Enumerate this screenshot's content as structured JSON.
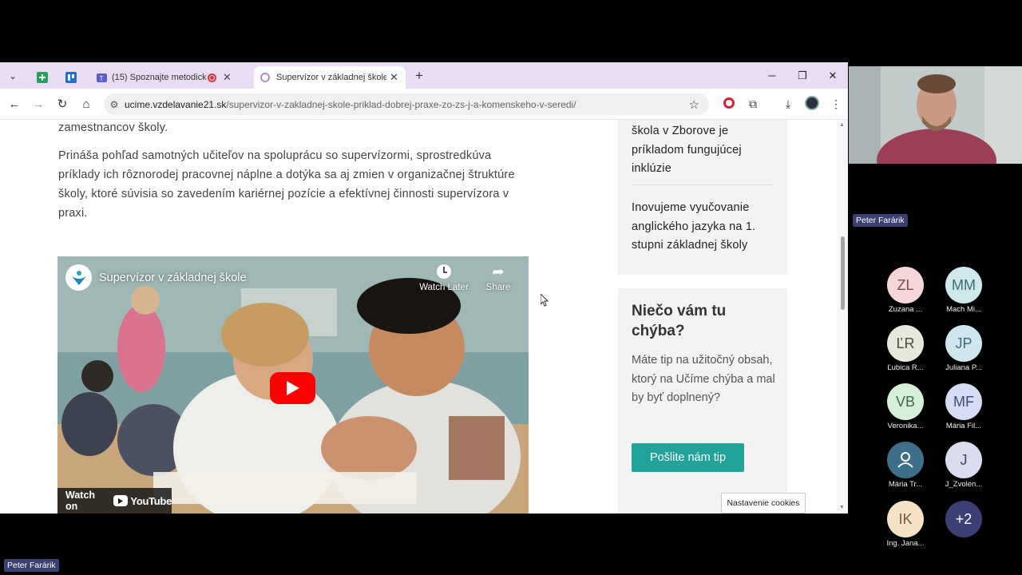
{
  "browser": {
    "tabs": [
      {
        "label": "(15) Spoznajte metodický p",
        "active": false
      },
      {
        "label": "Supervízor v základnej škole - p",
        "active": true
      }
    ],
    "url_domain": "ucime.vzdelavanie21.sk",
    "url_path": "/supervizor-v-zakladnej-skole-priklad-dobrej-praxe-zo-zs-j-a-komenskeho-v-seredi/"
  },
  "article": {
    "para1_tail": "zamestnancov školy.",
    "para2": "Prináša pohľad samotných učiteľov na spoluprácu so supervízormi, sprostredkúva príklady ich rôznorodej pracovnej náplne a dotýka sa aj zmien v organizačnej štruktúre školy, ktoré súvisia so zavedením kariérnej pozície a efektívnej činnosti supervízora v praxi."
  },
  "video": {
    "title": "Supervízor v základnej škole",
    "watch_later": "Watch Later",
    "share": "Share",
    "watch_on": "Watch on",
    "youtube": "YouTube"
  },
  "sidebar": {
    "link1": "škola v Zborove je príkladom fungujúcej inklúzie",
    "link2": "Inovujeme vyučovanie anglického jazyka na 1. stupni základnej školy",
    "heading": "Niečo vám tu chýba?",
    "text": "Máte tip na užitočný obsah, ktorý na Učíme chýba a mal by byť doplnený?",
    "button": "Pošlite nám tip"
  },
  "cookie_button": "Nastavenie cookies",
  "meeting": {
    "speaker": "Peter Farárik",
    "participants": [
      {
        "initials": "ZL",
        "name": "Zuzana ...",
        "bg": "#f6d6d8",
        "fg": "#7a4b4e"
      },
      {
        "initials": "MM",
        "name": "Mach Mi...",
        "bg": "#cfe8ec",
        "fg": "#3e6b72"
      },
      {
        "initials": "ĽR",
        "name": "Ľubica R...",
        "bg": "#e6e8dc",
        "fg": "#4a4c3e"
      },
      {
        "initials": "JP",
        "name": "Juliana P...",
        "bg": "#cfe6ee",
        "fg": "#3f6c7a"
      },
      {
        "initials": "VB",
        "name": "Veronika...",
        "bg": "#d5efd8",
        "fg": "#3f6b46"
      },
      {
        "initials": "MF",
        "name": "Mária Fil...",
        "bg": "#d5dcf3",
        "fg": "#3d4a7a"
      },
      {
        "initials": "",
        "name": "Mária Tr...",
        "bg": "#3d6f8a",
        "fg": "#ffffff"
      },
      {
        "initials": "J",
        "name": "J_Zvolen...",
        "bg": "#dcdcf1",
        "fg": "#3c3d6b"
      },
      {
        "initials": "IK",
        "name": "Ing. Jana...",
        "bg": "#f5e2c6",
        "fg": "#7a5730"
      },
      {
        "initials": "+2",
        "name": "",
        "bg": "#3c3f74",
        "fg": "#ffffff"
      }
    ]
  }
}
